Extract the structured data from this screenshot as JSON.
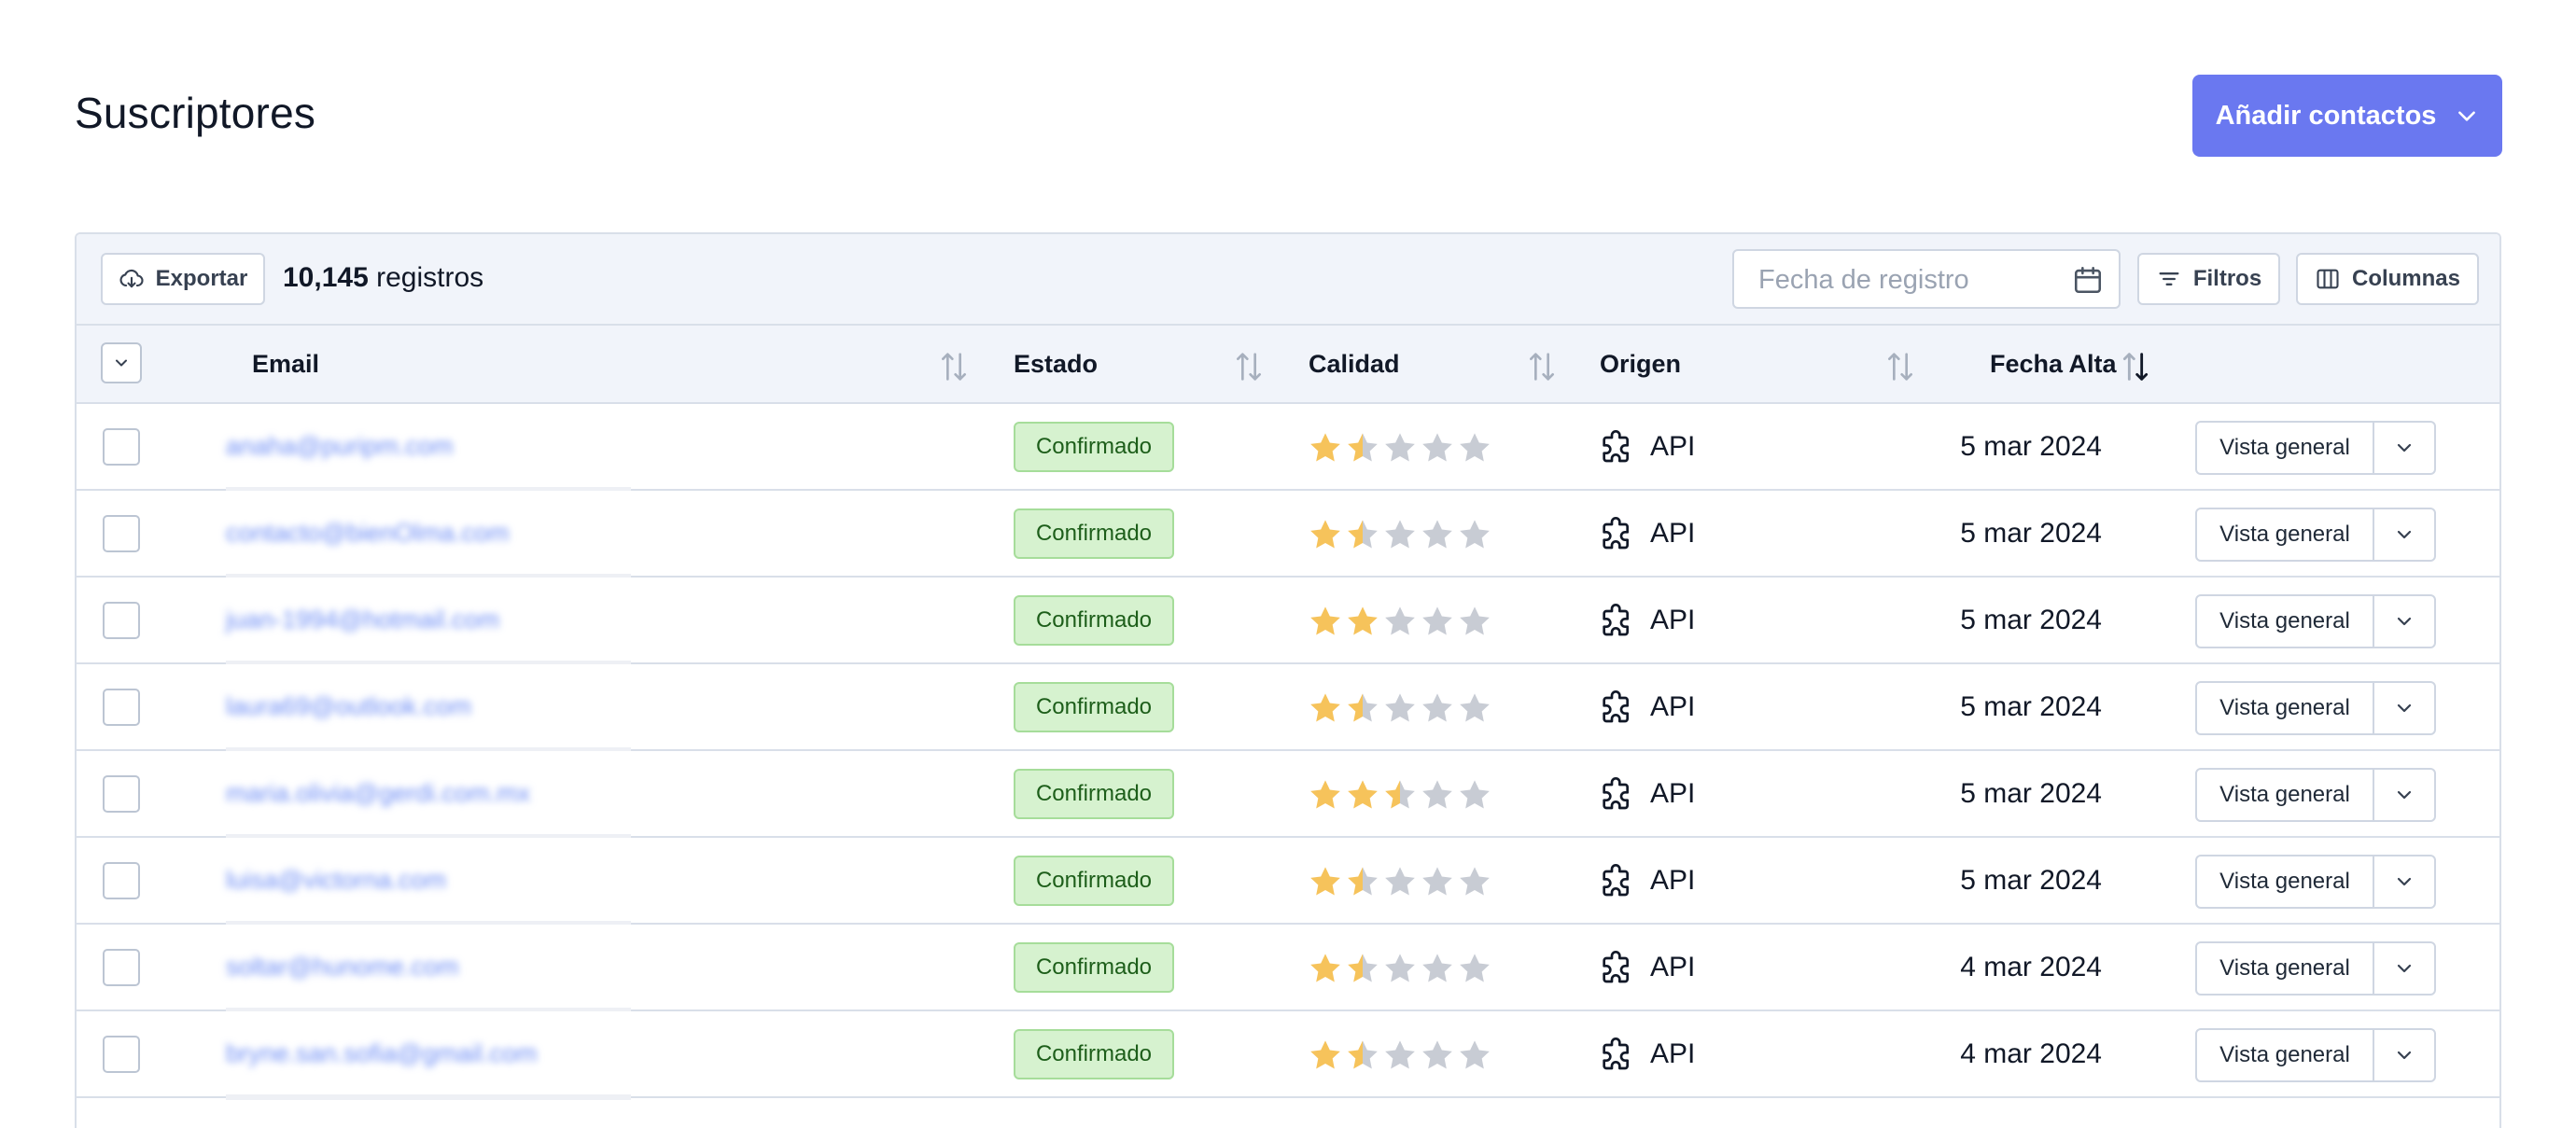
{
  "header": {
    "title": "Suscriptores",
    "add_button": "Añadir contactos"
  },
  "toolbar": {
    "export_label": "Exportar",
    "records_count": "10,145",
    "records_label": "registros",
    "date_placeholder": "Fecha de registro",
    "filters_label": "Filtros",
    "columns_label": "Columnas"
  },
  "columns": {
    "email": "Email",
    "status": "Estado",
    "quality": "Calidad",
    "origin": "Origen",
    "date": "Fecha Alta"
  },
  "colors": {
    "accent": "#6a78f0",
    "star_filled": "#f6c35b",
    "star_empty": "#c8ccd4",
    "badge_bg": "#d6f2cf",
    "badge_text": "#1d5e1a"
  },
  "rows": [
    {
      "email": "anaha@puripm.com",
      "status": "Confirmado",
      "rating": 1.5,
      "origin": "API",
      "date": "5 mar 2024",
      "action": "Vista general"
    },
    {
      "email": "contacto@bienOlma.com",
      "status": "Confirmado",
      "rating": 1.5,
      "origin": "API",
      "date": "5 mar 2024",
      "action": "Vista general"
    },
    {
      "email": "juan-1994@hotmail.com",
      "status": "Confirmado",
      "rating": 2,
      "origin": "API",
      "date": "5 mar 2024",
      "action": "Vista general"
    },
    {
      "email": "laura69@outlook.com",
      "status": "Confirmado",
      "rating": 1.5,
      "origin": "API",
      "date": "5 mar 2024",
      "action": "Vista general"
    },
    {
      "email": "maria.olivia@gerdi.com.mx",
      "status": "Confirmado",
      "rating": 2.5,
      "origin": "API",
      "date": "5 mar 2024",
      "action": "Vista general"
    },
    {
      "email": "luisa@victorna.com",
      "status": "Confirmado",
      "rating": 1.5,
      "origin": "API",
      "date": "5 mar 2024",
      "action": "Vista general"
    },
    {
      "email": "soltar@hunome.com",
      "status": "Confirmado",
      "rating": 1.5,
      "origin": "API",
      "date": "4 mar 2024",
      "action": "Vista general"
    },
    {
      "email": "bryne.san.sofia@gmail.com",
      "status": "Confirmado",
      "rating": 1.5,
      "origin": "API",
      "date": "4 mar 2024",
      "action": "Vista general"
    }
  ]
}
